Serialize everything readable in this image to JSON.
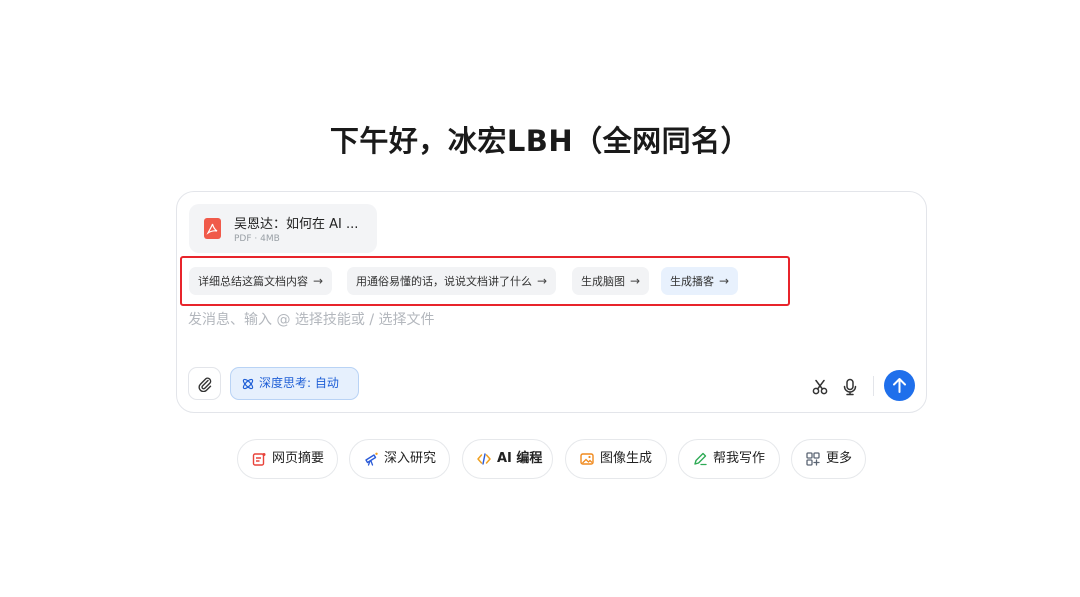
{
  "greeting": "下午好，冰宏LBH（全网同名）",
  "file": {
    "name": "吴恩达：如何在 AI ...",
    "meta": "PDF · 4MB"
  },
  "suggestions": [
    {
      "label": "详细总结这篇文档内容",
      "arrow": "→"
    },
    {
      "label": "用通俗易懂的话，说说文档讲了什么",
      "arrow": "→"
    },
    {
      "label": "生成脑图",
      "arrow": "→"
    },
    {
      "label": "生成播客",
      "arrow": "→"
    }
  ],
  "input": {
    "placeholder": "发消息、输入 @ 选择技能或 / 选择文件"
  },
  "toolbar": {
    "deep_think_label": "深度思考: 自动"
  },
  "skills": [
    {
      "label": "网页摘要",
      "icon": "web-summary-icon",
      "color": "#e8433a"
    },
    {
      "label": "深入研究",
      "icon": "telescope-icon",
      "color": "#2b5bd7"
    },
    {
      "label": "AI 编程",
      "icon": "code-icon",
      "color": "#f0a020"
    },
    {
      "label": "图像生成",
      "icon": "image-gen-icon",
      "color": "#f08a1e"
    },
    {
      "label": "帮我写作",
      "icon": "pen-icon",
      "color": "#2eaa55"
    },
    {
      "label": "更多",
      "icon": "grid-icon",
      "color": "#5b6573"
    }
  ],
  "colors": {
    "accent": "#1f6feb",
    "highlight": "#e8242b"
  }
}
